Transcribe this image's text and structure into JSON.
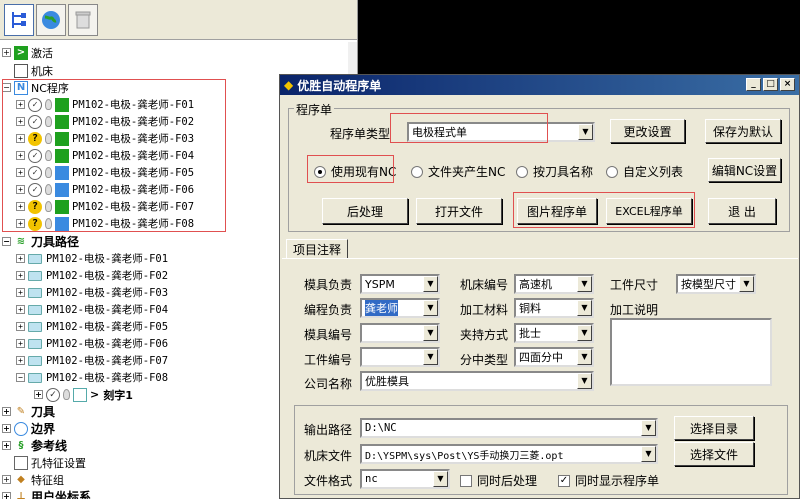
{
  "tree": {
    "activate": "激活",
    "machine": "机床",
    "nc_program": "NC程序",
    "nc_items": [
      "PM102-电极-龚老师-F01",
      "PM102-电极-龚老师-F02",
      "PM102-电极-龚老师-F03",
      "PM102-电极-龚老师-F04",
      "PM102-电极-龚老师-F05",
      "PM102-电极-龚老师-F06",
      "PM102-电极-龚老师-F07",
      "PM102-电极-龚老师-F08"
    ],
    "toolpath": "刀具路径",
    "toolpath_items": [
      "PM102-电极-龚老师-F01",
      "PM102-电极-龚老师-F02",
      "PM102-电极-龚老师-F03",
      "PM102-电极-龚老师-F04",
      "PM102-电极-龚老师-F05",
      "PM102-电极-龚老师-F06",
      "PM102-电极-龚老师-F07",
      "PM102-电极-龚老师-F08"
    ],
    "sub_item": "刻字1",
    "tool": "刀具",
    "boundary": "边界",
    "reference_line": "参考线",
    "hole_feature": "孔特征设置",
    "feature_group": "特征组",
    "user_coord": "用户坐标系"
  },
  "dialog": {
    "title": "优胜自动程序单",
    "group_title": "程序单",
    "type_label": "程序单类型",
    "type_value": "电极程式单",
    "btn_change_settings": "更改设置",
    "btn_save_default": "保存为默认",
    "radios": [
      "使用现有NC",
      "文件夹产生NC",
      "按刀具名称",
      "自定义列表"
    ],
    "btn_edit_nc": "编辑NC设置",
    "btn_post": "后处理",
    "btn_open_file": "打开文件",
    "btn_image_sheet": "图片程序单",
    "btn_excel_sheet": "EXCEL程序单",
    "btn_exit": "退 出",
    "tab_label": "项目注释",
    "fields": {
      "mold_owner_label": "模具负责",
      "mold_owner_value": "YSPM",
      "machine_no_label": "机床编号",
      "machine_no_value": "高速机",
      "workpiece_size_label": "工件尺寸",
      "workpiece_size_value": "按模型尺寸",
      "programmer_label": "编程负责",
      "programmer_value": "龚老师",
      "material_label": "加工材料",
      "material_value": "铜料",
      "notes_label": "加工说明",
      "mold_no_label": "模具编号",
      "mold_no_value": "",
      "clamp_label": "夹持方式",
      "clamp_value": "批士",
      "workpiece_no_label": "工件编号",
      "workpiece_no_value": "",
      "split_label": "分中类型",
      "split_value": "四面分中",
      "company_label": "公司名称",
      "company_value": "优胜模具"
    },
    "output": {
      "path_label": "输出路径",
      "path_value": "D:\\NC",
      "btn_select_dir": "选择目录",
      "machine_file_label": "机床文件",
      "machine_file_value": "D:\\YSPM\\sys\\Post\\YS手动换刀三菱.opt",
      "btn_select_file": "选择文件",
      "format_label": "文件格式",
      "format_value": "nc",
      "chk_post": "同时后处理",
      "chk_show": "同时显示程序单"
    }
  }
}
